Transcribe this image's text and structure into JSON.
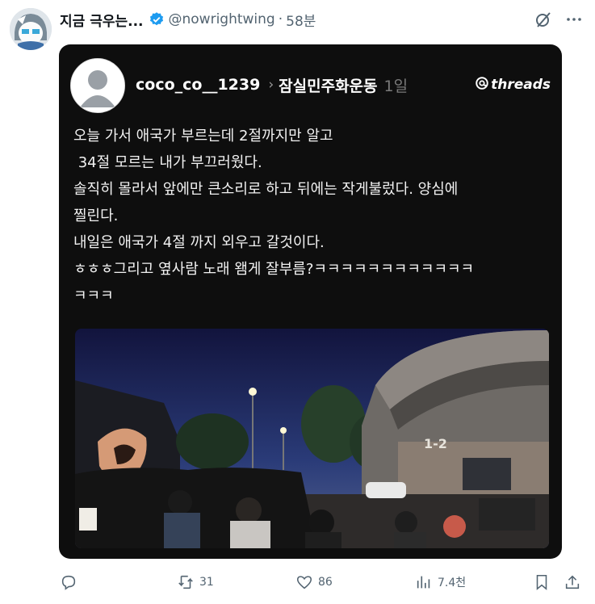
{
  "tweet": {
    "display_name": "지금 극우는...",
    "handle": "@nowrightwing",
    "separator": "·",
    "time": "58분"
  },
  "threads": {
    "username": "coco_co__1239",
    "chevron": "›",
    "tag": "잠실민주화운동",
    "age": "1일",
    "brand": "threads",
    "lines": [
      "오늘 가서 애국가 부르는데 2절까지만 알고",
      " 34절 모르는 내가 부끄러웠다.",
      "솔직히 몰라서 앞에만 큰소리로 하고 뒤에는 작게불렀다. 양심에",
      "찔린다.",
      "내일은 애국가 4절 까지 외우고 갈것이다.",
      "ㅎㅎㅎ그리고 옆사람 노래 왬게 잘부름?ㅋㅋㅋㅋㅋㅋㅋㅋㅋㅋㅋㅋ",
      "ㅋㅋㅋ"
    ],
    "photo_sign": "1-2"
  },
  "actions": {
    "replies": "",
    "retweets": "31",
    "likes": "86",
    "views": "7.4천"
  },
  "colors": {
    "verified": "#1d9bf0",
    "muted": "#536471",
    "card_bg": "#0e0e0e"
  },
  "icons": [
    "grok-icon",
    "more-icon",
    "verified-icon",
    "reply-icon",
    "retweet-icon",
    "like-icon",
    "views-icon",
    "bookmark-icon",
    "share-icon"
  ]
}
